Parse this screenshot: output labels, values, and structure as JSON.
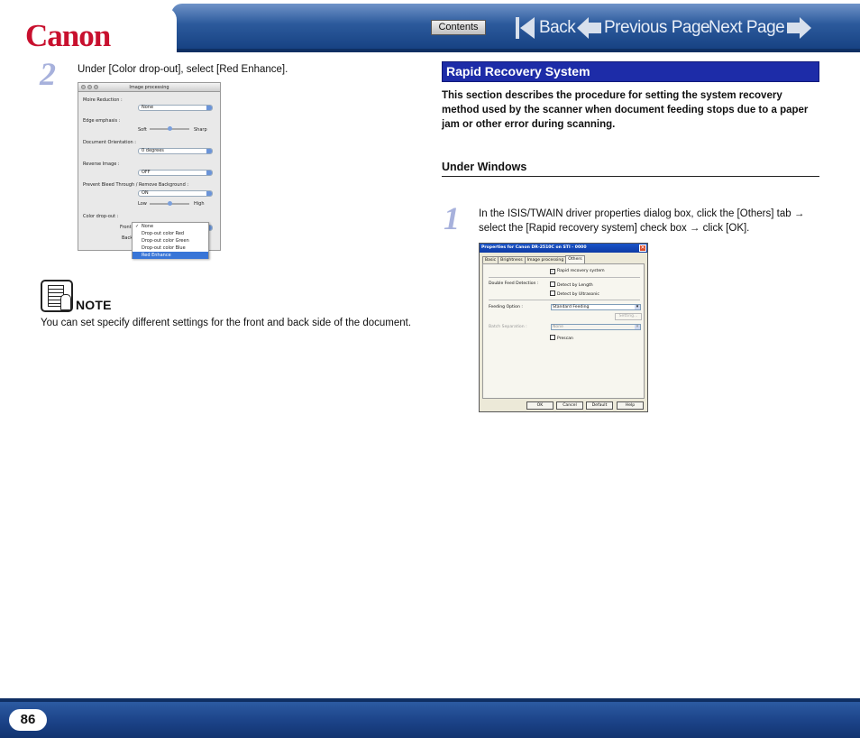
{
  "header": {
    "logo": "Canon",
    "contents_label": "Contents",
    "back_label": "Back",
    "prev_label": "Previous Page",
    "next_label": "Next Page"
  },
  "left": {
    "step_number": "2",
    "step_text": "Under [Color drop-out], select [Red Enhance].",
    "screenshot": {
      "title": "Image processing",
      "moire_label": "Moire Reduction :",
      "moire_value": "None",
      "edge_label": "Edge emphasis :",
      "edge_low": "Soft",
      "edge_high": "Sharp",
      "orientation_label": "Document Orientation :",
      "orientation_value": "0 degrees",
      "reverse_label": "Reverse Image :",
      "reverse_value": "OFF",
      "bleed_label": "Prevent Bleed Through / Remove Background :",
      "bleed_value": "ON",
      "bleed_low": "Low",
      "bleed_high": "High",
      "dropout_label": "Color drop-out :",
      "front_label": "Front",
      "back_label": "Back",
      "menu_items": [
        "None",
        "Drop-out color Red",
        "Drop-out color Green",
        "Drop-out color Blue",
        "Red Enhance"
      ]
    },
    "note_label": "NOTE",
    "note_text": "You can set specify different settings for the front and back side of the document."
  },
  "right": {
    "section_title": "Rapid Recovery System",
    "intro": "This section describes the procedure for setting the system recovery method used by the scanner when document feeding stops due to a paper jam or other error during scanning.",
    "subheading": "Under Windows",
    "step_number": "1",
    "step_text": "In the ISIS/TWAIN driver properties dialog box, click the [Others] tab → select the [Rapid recovery system] check box → click [OK].",
    "dialog": {
      "title": "Properties for Canon DR-2510C on STI - 0000",
      "close": "✕",
      "tabs": [
        "Basic",
        "Brightness",
        "Image processing",
        "Others"
      ],
      "rapid_recovery": "Rapid recovery system",
      "double_feed_label": "Double Feed Detection :",
      "detect_length": "Detect by Length",
      "detect_ultrasonic": "Detect by Ultrasonic",
      "feeding_label": "Feeding Option :",
      "feeding_value": "Standard Feeding",
      "setting_button": "Setting...",
      "batch_label": "Batch Separation :",
      "batch_value": "None",
      "prescan": "Prescan",
      "buttons": [
        "OK",
        "Cancel",
        "Default",
        "Help"
      ]
    }
  },
  "footer": {
    "page_number": "86"
  }
}
